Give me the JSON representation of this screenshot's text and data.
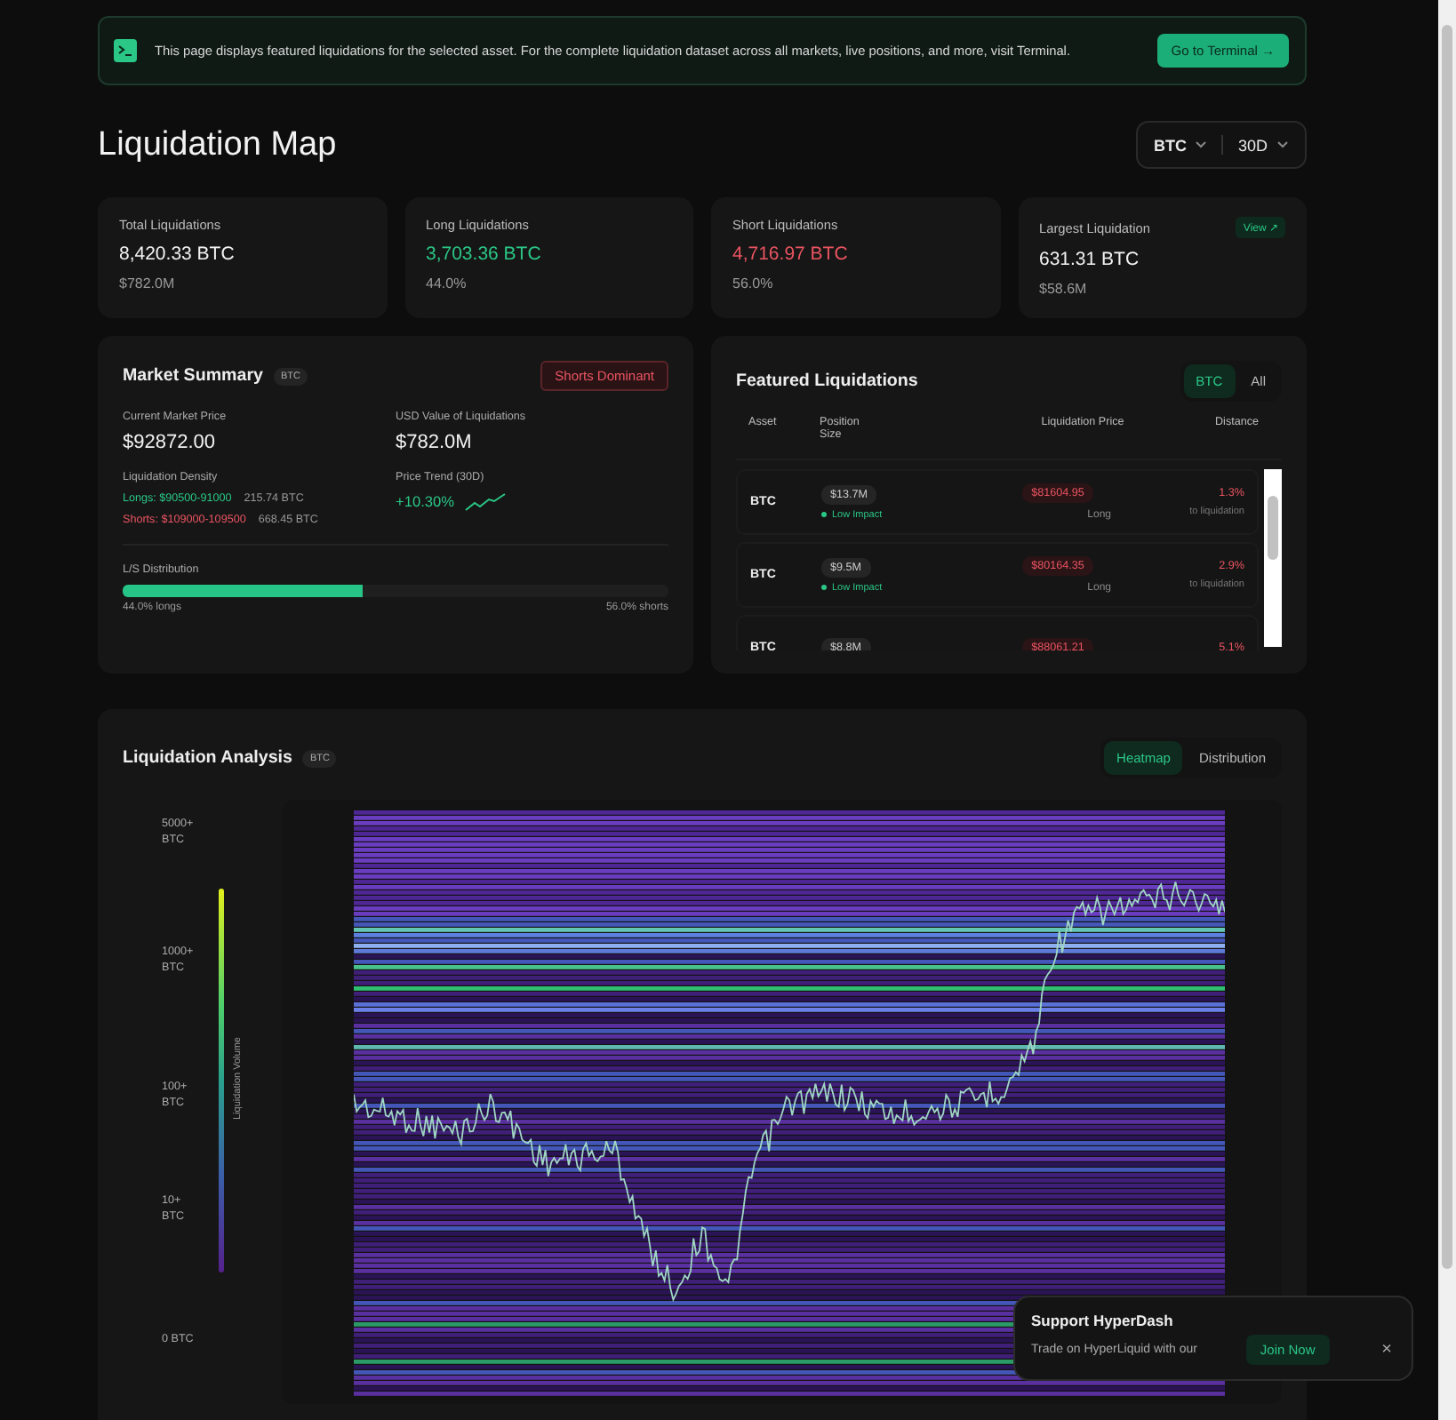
{
  "banner": {
    "text": "This page displays featured liquidations for the selected asset. For the complete liquidation dataset across all markets, live positions, and more, visit Terminal.",
    "button": "Go to Terminal →"
  },
  "header": {
    "title": "Liquidation Map",
    "asset_select": "BTC",
    "range_select": "30D"
  },
  "stats": [
    {
      "label": "Total Liquidations",
      "value": "8,420.33 BTC",
      "sub": "$782.0M",
      "color": "#f2f2f2"
    },
    {
      "label": "Long Liquidations",
      "value": "3,703.36 BTC",
      "sub": "44.0%",
      "color": "#2ac786"
    },
    {
      "label": "Short Liquidations",
      "value": "4,716.97 BTC",
      "sub": "56.0%",
      "color": "#ea5461"
    },
    {
      "label": "Largest Liquidation",
      "value": "631.31 BTC",
      "sub": "$58.6M",
      "color": "#f2f2f2",
      "link": "View ↗"
    }
  ],
  "market_summary": {
    "title": "Market Summary",
    "badge": "BTC",
    "status": "Shorts Dominant",
    "price_label": "Current Market Price",
    "price": "$92872.00",
    "usd_label": "USD Value of Liquidations",
    "usd_value": "$782.0M",
    "density_label": "Liquidation Density",
    "longs_range": "Longs: $90500-91000",
    "longs_amount": "215.74 BTC",
    "shorts_range": "Shorts: $109000-109500",
    "shorts_amount": "668.45 BTC",
    "trend_label": "Price Trend (30D)",
    "trend_value": "+10.30%",
    "dist_label": "L/S Distribution",
    "level": 0.44,
    "longs_text": "44.0% longs",
    "shorts_text": "56.0% shorts"
  },
  "featured": {
    "title": "Featured Liquidations",
    "filters": [
      {
        "label": "BTC",
        "selected": true
      },
      {
        "label": "All",
        "selected": false
      }
    ],
    "columns": [
      "Asset",
      "Position Size",
      "Liquidation Price",
      "Distance"
    ],
    "rows": [
      {
        "asset": "BTC",
        "size": "$13.7M",
        "impact": "Low Impact",
        "price": "$81604.95",
        "side": "Long",
        "distance": "1.3%",
        "note": "to liquidation"
      },
      {
        "asset": "BTC",
        "size": "$9.5M",
        "impact": "Low Impact",
        "price": "$80164.35",
        "side": "Long",
        "distance": "2.9%",
        "note": "to liquidation"
      },
      {
        "asset": "BTC",
        "size": "$8.8M",
        "price": "$88061.21",
        "distance": "5.1%"
      }
    ]
  },
  "analysis": {
    "title": "Liquidation Analysis",
    "badge": "BTC",
    "views": [
      {
        "label": "Heatmap",
        "selected": true
      },
      {
        "label": "Distribution",
        "selected": false
      }
    ],
    "legend_title": "Liquidation Volume",
    "legend_ticks": [
      "5000+ BTC",
      "1000+ BTC",
      "100+ BTC",
      "10+ BTC",
      "0 BTC"
    ]
  },
  "popup": {
    "title": "Support HyperDash",
    "text": "Trade on HyperLiquid with our",
    "button": "Join Now",
    "close": "×"
  }
}
